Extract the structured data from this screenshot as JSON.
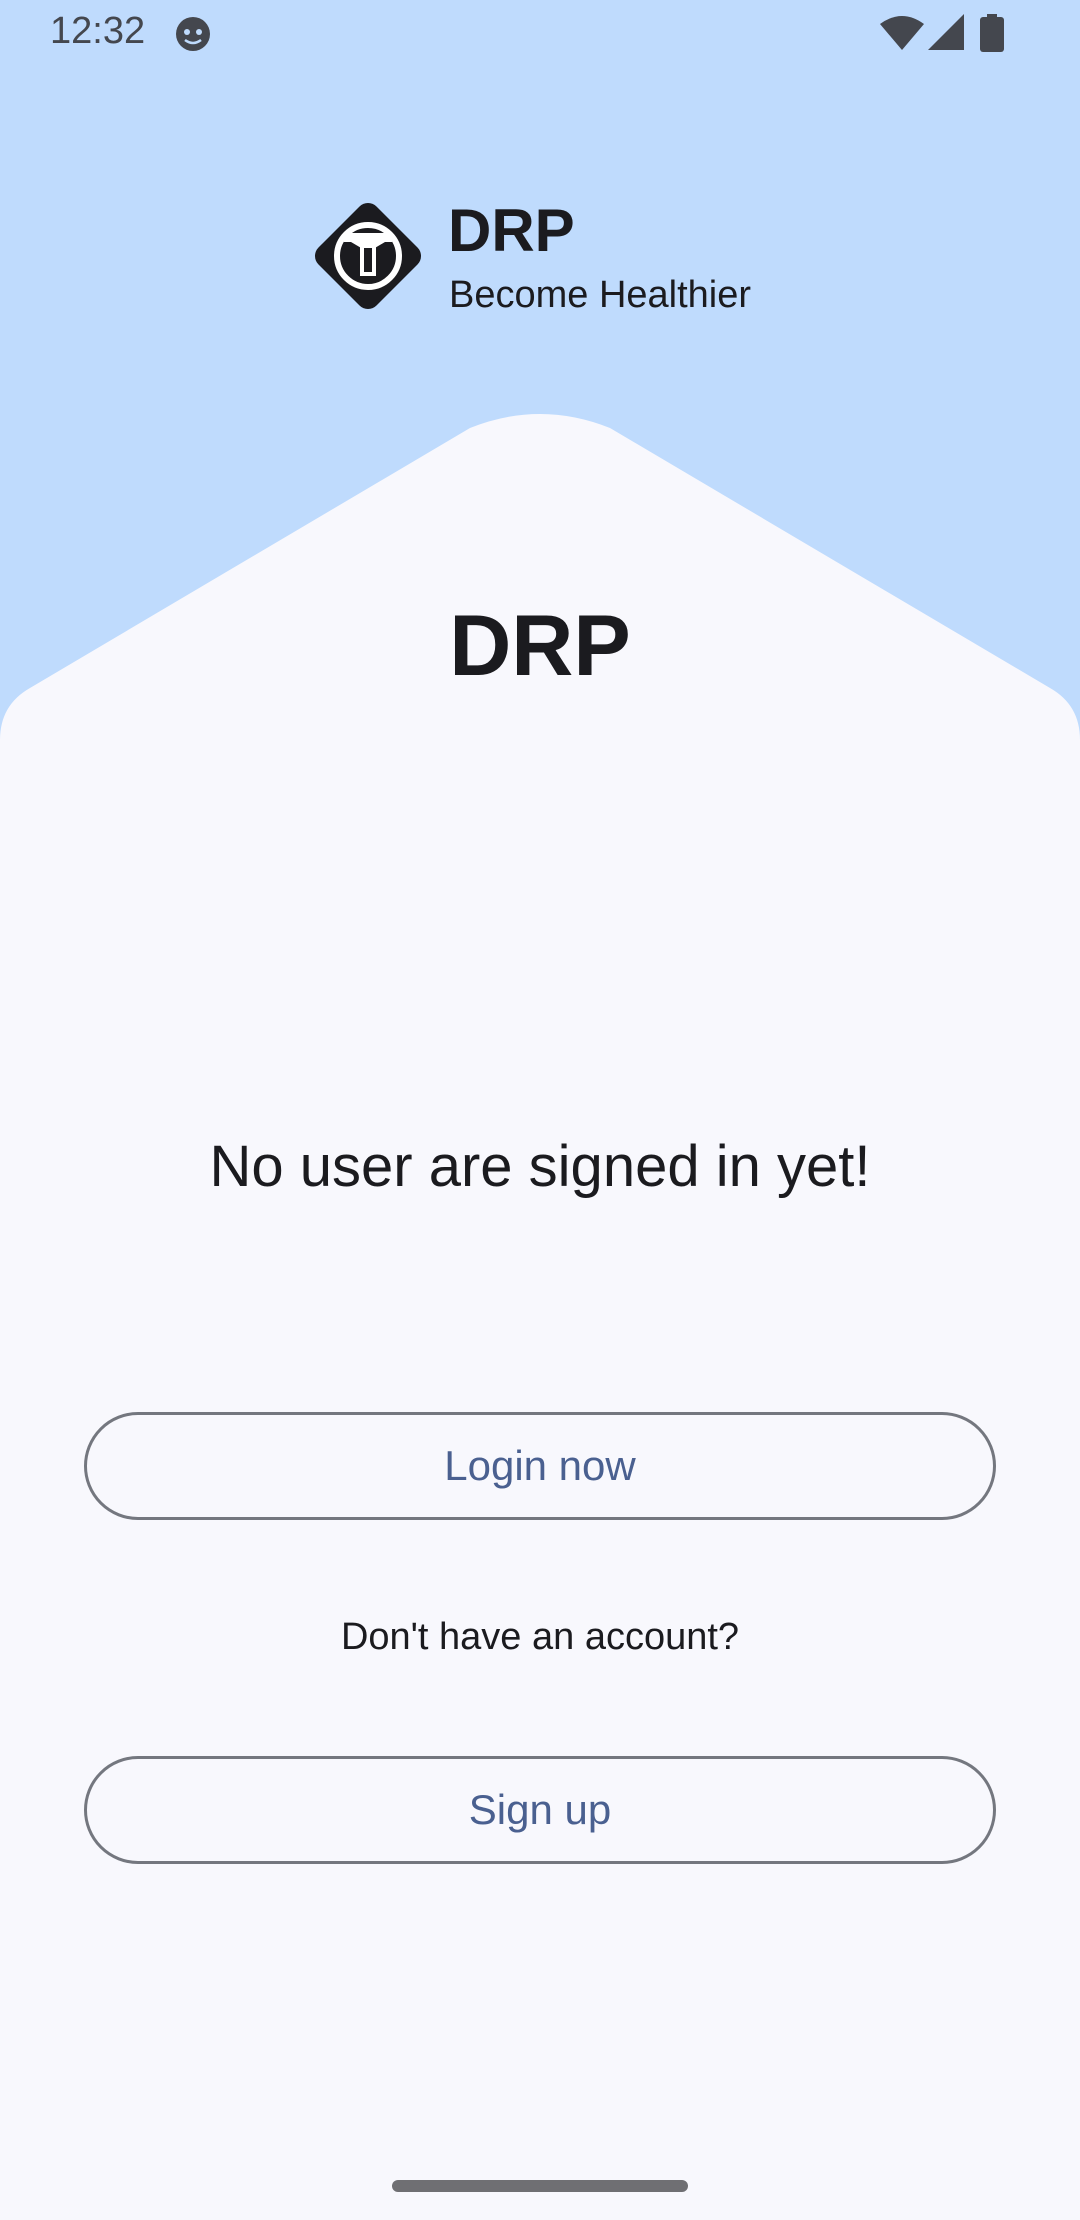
{
  "colors": {
    "header_bg": "#bfdbfd",
    "surface": "#f8f8fd",
    "on_surface": "#1b1b1f",
    "outline": "#74777f",
    "primary": "#4a6090"
  },
  "status_bar": {
    "time": "12:32",
    "icons": [
      "app-notification-icon",
      "wifi-icon",
      "cell-signal-icon",
      "battery-icon"
    ]
  },
  "brand": {
    "name": "DRP",
    "tagline": "Become Healthier",
    "logo_icon": "drp-diamond-logo-icon"
  },
  "main": {
    "title": "DRP",
    "empty_message": "No user are signed in yet!",
    "login_label": "Login now",
    "no_account_text": "Don't have an account?",
    "signup_label": "Sign up"
  }
}
